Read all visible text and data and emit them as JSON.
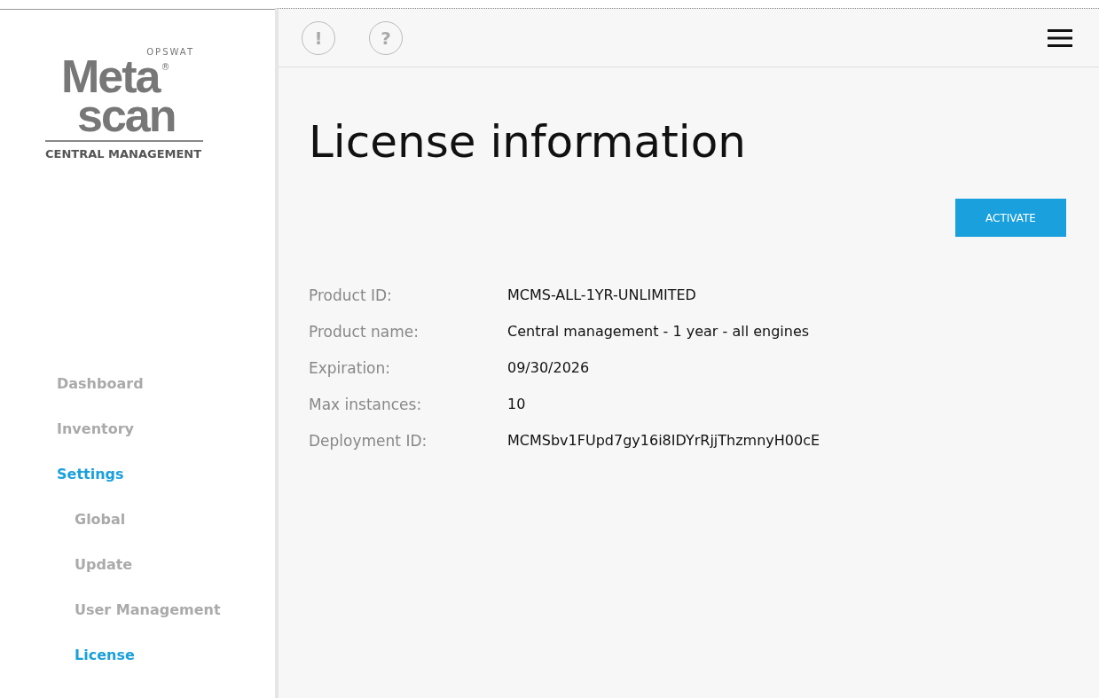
{
  "logo": {
    "brand": "OPSWAT",
    "line1": "Meta",
    "line2": "scan",
    "mark": "®",
    "subtitle": "CENTRAL MANAGEMENT"
  },
  "toolbar": {
    "alert": "!",
    "help": "?"
  },
  "nav": [
    {
      "label": "Dashboard",
      "selected": false
    },
    {
      "label": "Inventory",
      "selected": false
    },
    {
      "label": "Settings",
      "selected": true,
      "children": [
        {
          "label": "Global",
          "selected": false
        },
        {
          "label": "Update",
          "selected": false
        },
        {
          "label": "User Management",
          "selected": false
        },
        {
          "label": "License",
          "selected": true
        }
      ]
    }
  ],
  "page": {
    "title": "License information",
    "action": "ACTIVATE",
    "fields": [
      {
        "label": "Product ID:",
        "value": "MCMS-ALL-1YR-UNLIMITED"
      },
      {
        "label": "Product name:",
        "value": "Central management - 1 year - all engines"
      },
      {
        "label": "Expiration:",
        "value": "09/30/2026"
      },
      {
        "label": "Max instances:",
        "value": "10"
      },
      {
        "label": "Deployment ID:",
        "value": "MCMSbv1FUpd7gy16i8IDYrRjjThzmnyH00cE"
      }
    ]
  }
}
